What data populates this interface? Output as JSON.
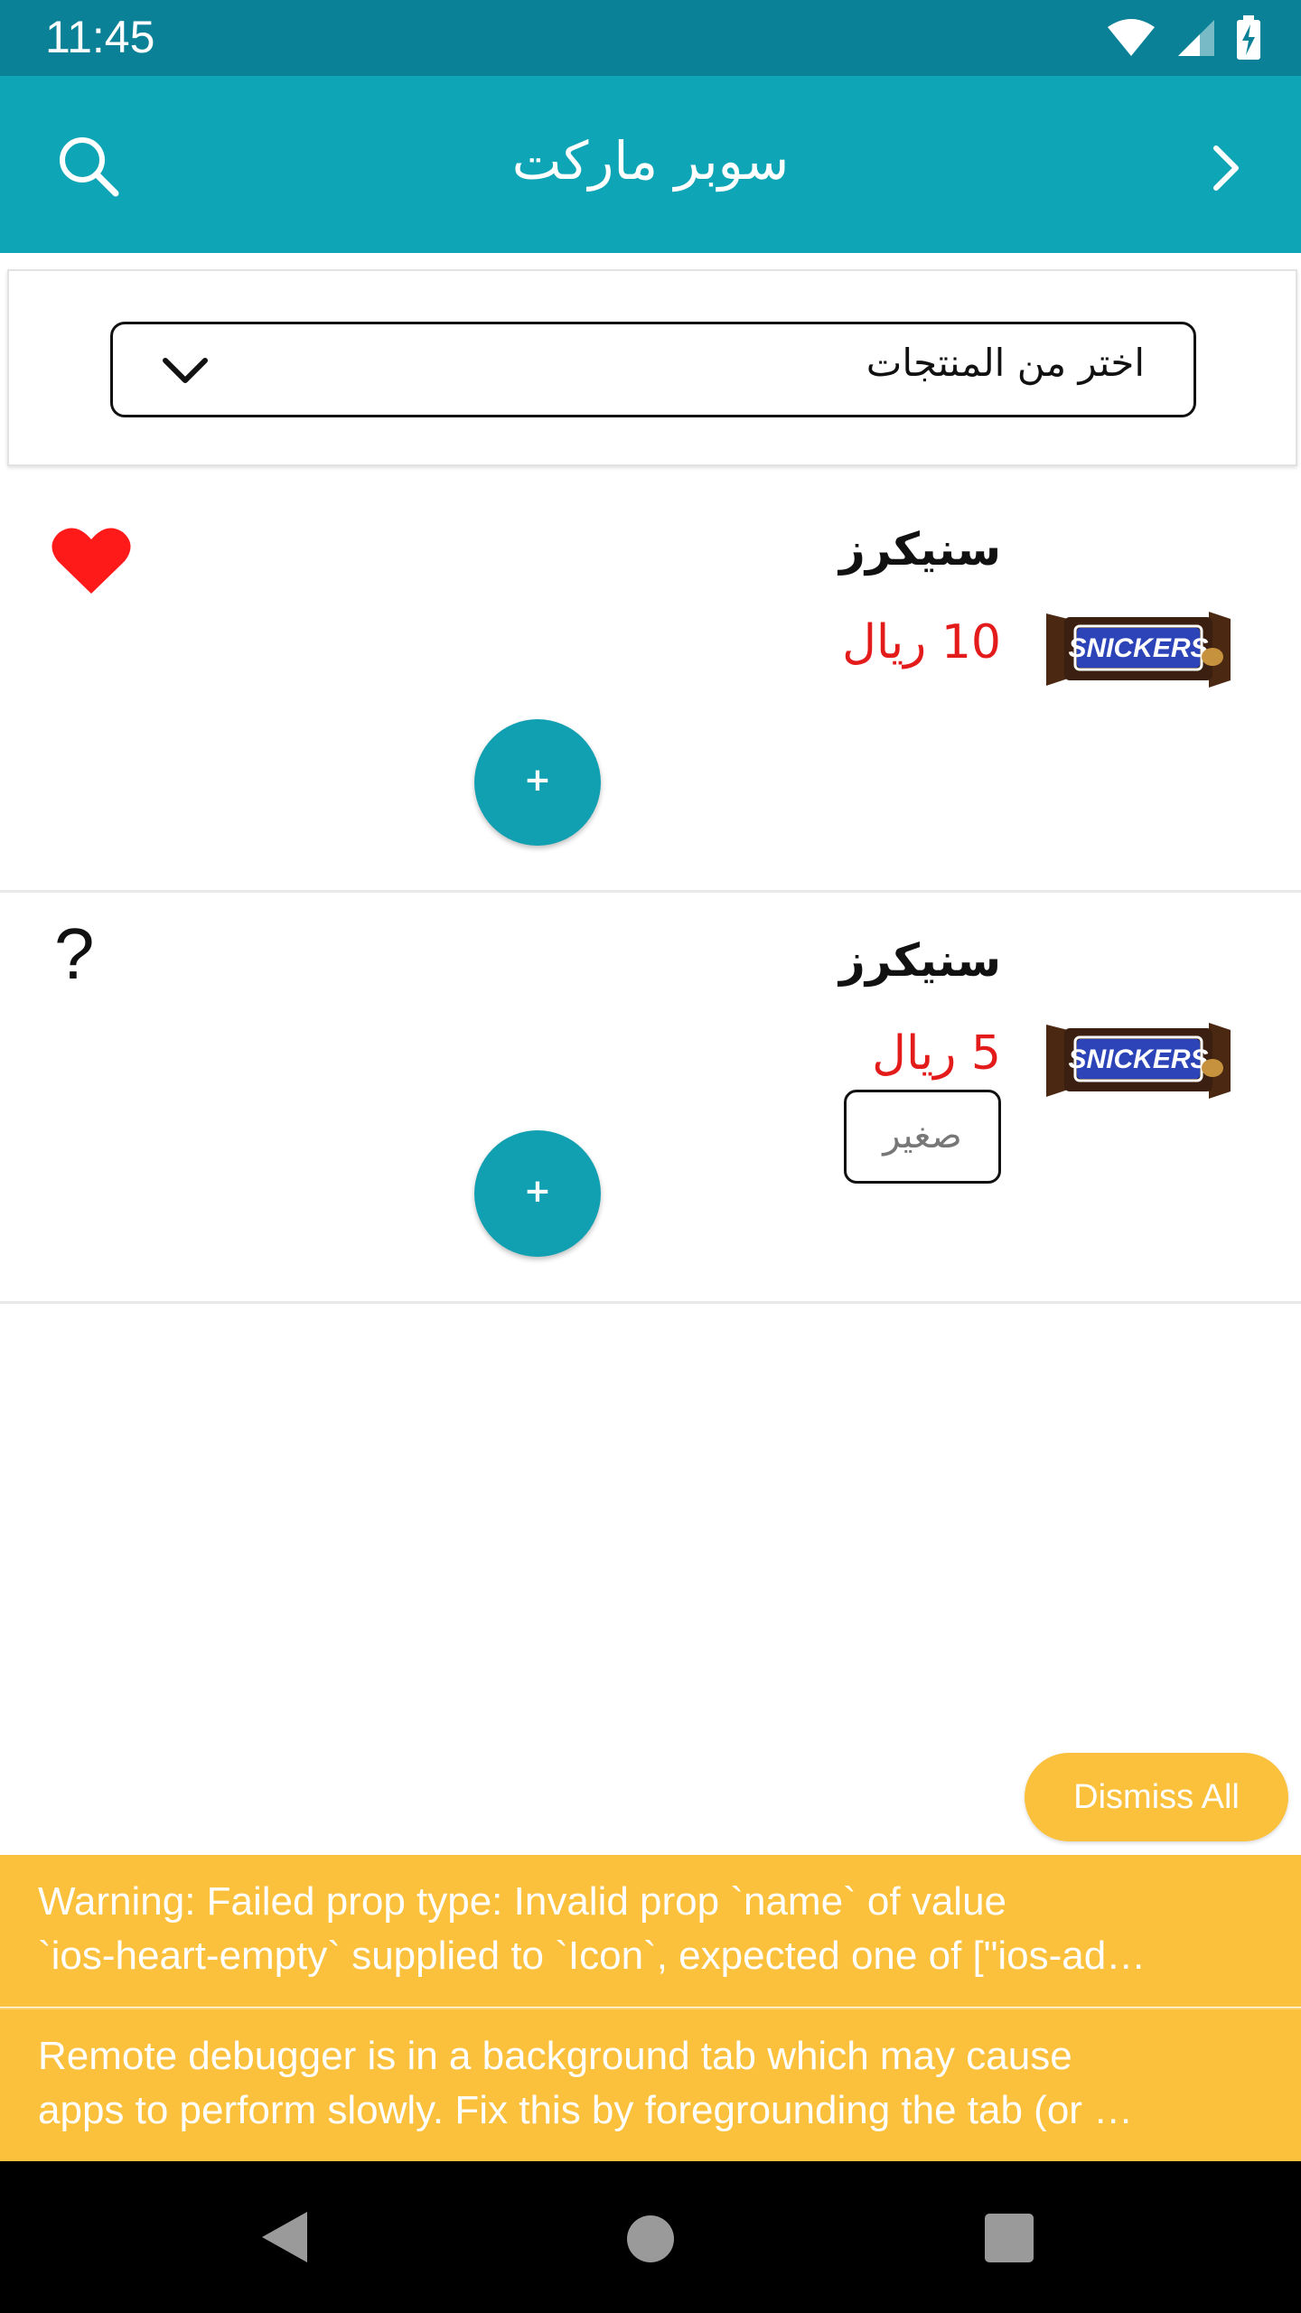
{
  "status_bar": {
    "time": "11:45",
    "icons": [
      "wifi-icon",
      "signal-icon",
      "battery-charging-icon"
    ]
  },
  "app_bar": {
    "title": "سوبر ماركت",
    "search_icon": "search-icon",
    "back_icon": "chevron-right-icon"
  },
  "filter": {
    "placeholder": "اختر من المنتجات",
    "icon": "chevron-down-icon"
  },
  "products": [
    {
      "name": "سنيكرز",
      "price": "10 ريال",
      "image_label": "SNICKERS",
      "favorite": "heart-filled-icon",
      "add_label": "+"
    },
    {
      "name": "سنيكرز",
      "price": "5 ريال",
      "image_label": "SNICKERS",
      "size": "صغير",
      "favorite_placeholder": "?",
      "add_label": "+"
    }
  ],
  "debug": {
    "dismiss_label": "Dismiss All",
    "warnings": [
      {
        "line1": "Warning: Failed prop type: Invalid prop `name` of value",
        "line2": "`ios-heart-empty` supplied to `Icon`, expected one of [\"ios-ad…"
      },
      {
        "line1": "Remote debugger is in a background tab which may cause",
        "line2": "apps to perform slowly. Fix this by foregrounding the tab (or …"
      }
    ]
  },
  "nav_bar": {
    "icons": [
      "back-triangle-icon",
      "home-circle-icon",
      "recents-square-icon"
    ]
  },
  "colors": {
    "header": "#0ea5b6",
    "status": "#0a8196",
    "price": "#e41b1b",
    "warning": "#fbc13c",
    "fab": "#11a0b2",
    "heart": "#ff1a1a"
  }
}
